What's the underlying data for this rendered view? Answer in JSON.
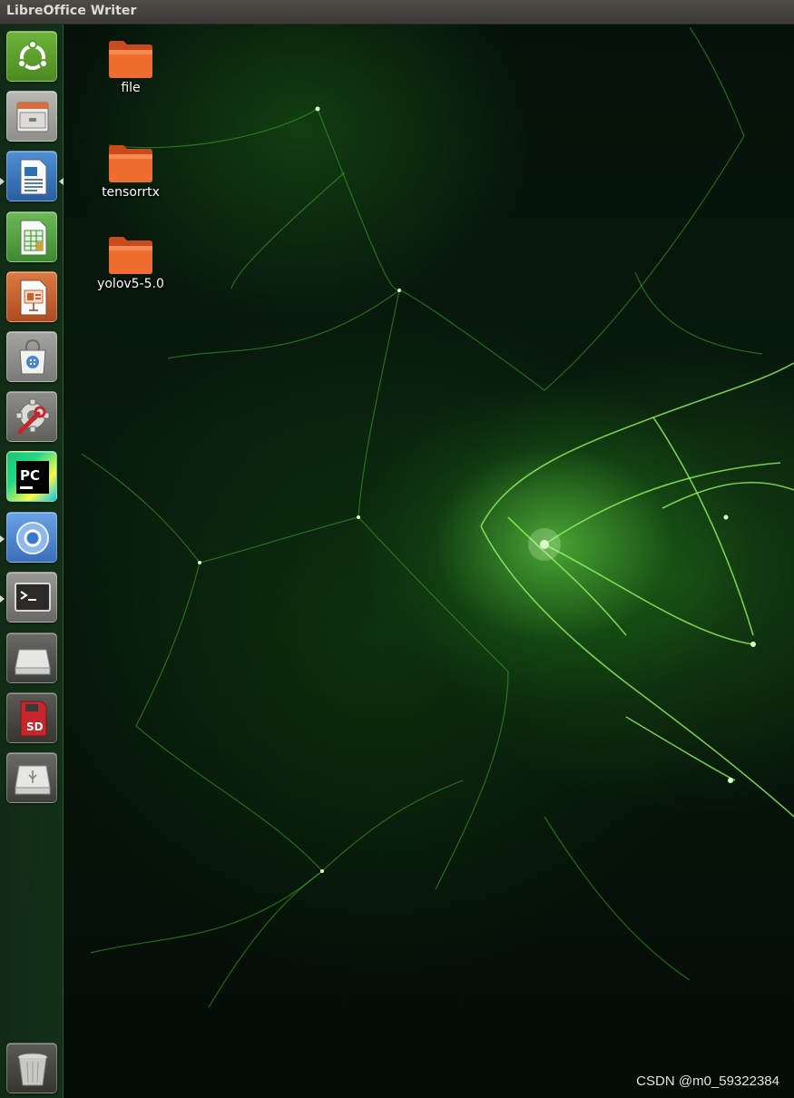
{
  "top_bar": {
    "title": "LibreOffice Writer"
  },
  "launcher": {
    "items": [
      {
        "name": "Dash",
        "icon": "ubuntu-logo-icon",
        "color": "#5a9a2c",
        "running": false
      },
      {
        "name": "Files",
        "icon": "file-cabinet-icon",
        "color": "#9c9c98",
        "running": false
      },
      {
        "name": "LibreOffice Writer",
        "icon": "writer-document-icon",
        "color": "#2f6eb5",
        "running": true,
        "focused": true
      },
      {
        "name": "LibreOffice Calc",
        "icon": "spreadsheet-icon",
        "color": "#4a9a3a",
        "running": false
      },
      {
        "name": "LibreOffice Impress",
        "icon": "presentation-icon",
        "color": "#c5622f",
        "running": false
      },
      {
        "name": "Ubuntu Software",
        "icon": "shopping-bag-icon",
        "color": "#8a8a86",
        "running": false
      },
      {
        "name": "System Settings",
        "icon": "settings-wrench-icon",
        "color": "#7a7a76",
        "running": false
      },
      {
        "name": "PyCharm",
        "icon": "pycharm-icon",
        "color": "#1a9a5a",
        "running": false
      },
      {
        "name": "Chromium",
        "icon": "chromium-icon",
        "color": "#4a86d6",
        "running": true
      },
      {
        "name": "Terminal",
        "icon": "terminal-icon",
        "color": "#5e5c58",
        "running": true
      },
      {
        "name": "Drive",
        "icon": "drive-icon",
        "color": "#c9c9c6",
        "running": false
      },
      {
        "name": "SD Card",
        "icon": "sd-card-icon",
        "color": "#b81f25",
        "running": false
      },
      {
        "name": "USB Drive",
        "icon": "usb-drive-icon",
        "color": "#c9c9c6",
        "running": false
      }
    ],
    "trash": {
      "name": "Trash",
      "icon": "trash-icon"
    }
  },
  "desktop": {
    "icons": [
      {
        "label": "file",
        "icon": "folder-icon",
        "color": "#e8602a"
      },
      {
        "label": "tensorrtx",
        "icon": "folder-icon",
        "color": "#e8602a"
      },
      {
        "label": "yolov5-5.0",
        "icon": "folder-icon",
        "color": "#e8602a"
      }
    ]
  },
  "watermark": {
    "text": "CSDN @m0_59322384"
  }
}
